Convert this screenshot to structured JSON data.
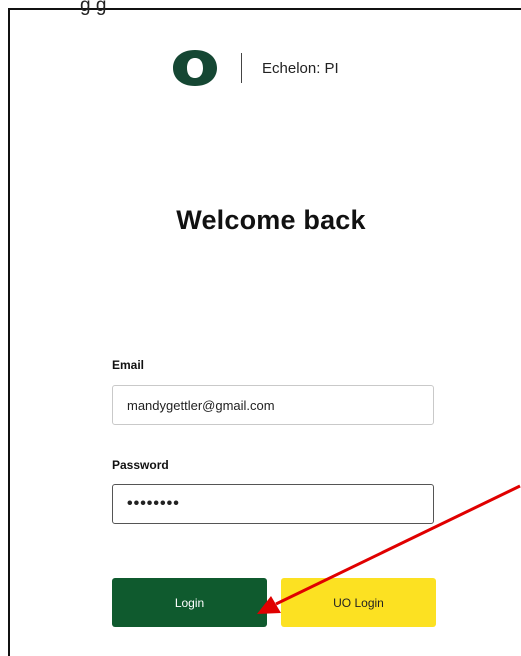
{
  "top_cut_text": "g   g",
  "brand": {
    "name": "Echelon: PI",
    "logo_icon": "oregon-o-logo",
    "logo_color": "#154733"
  },
  "heading": "Welcome back",
  "form": {
    "email_label": "Email",
    "email_value": "mandygettler@gmail.com",
    "password_label": "Password",
    "password_value": "••••••••"
  },
  "buttons": {
    "login_label": "Login",
    "uo_login_label": "UO Login"
  },
  "colors": {
    "login_bg": "#0f5a2e",
    "uo_login_bg": "#fce122",
    "annotation_arrow": "#e00000"
  }
}
